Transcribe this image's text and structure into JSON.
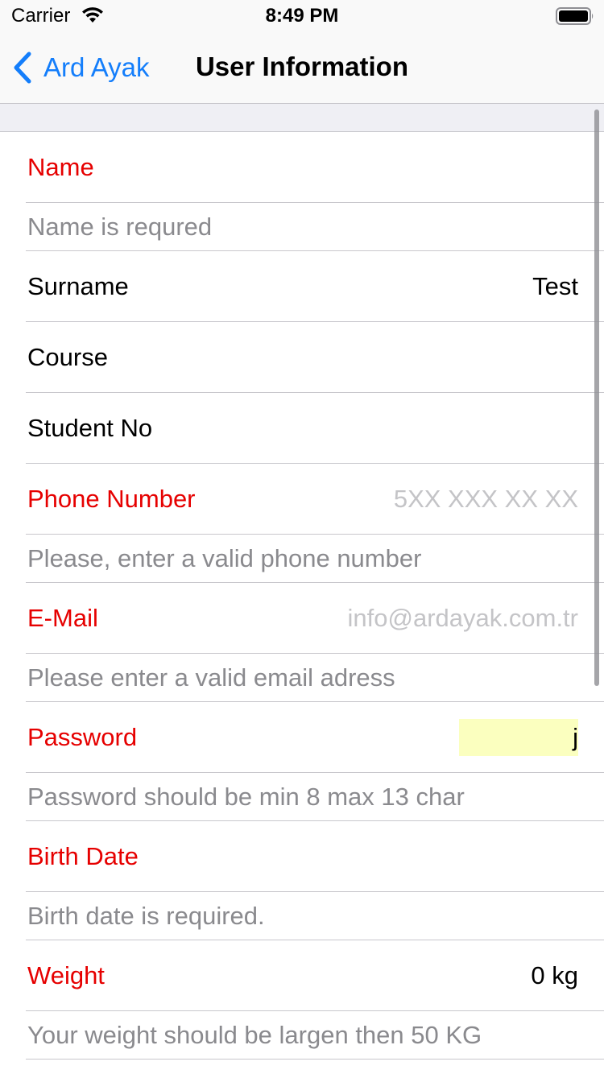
{
  "status_bar": {
    "carrier": "Carrier",
    "time": "8:49 PM",
    "wifi_icon": "wifi-icon",
    "battery_icon": "battery-icon"
  },
  "nav": {
    "back_label": "Ard Ayak",
    "title": "User Information"
  },
  "colors": {
    "error": "#e60000",
    "accent": "#147efb",
    "note": "#8a8a8e",
    "placeholder": "#c4c4c7",
    "highlight": "#fbffbf"
  },
  "form": {
    "name": {
      "label": "Name",
      "value": ""
    },
    "name_error": "Name is requred",
    "surname": {
      "label": "Surname",
      "value": "Test"
    },
    "course": {
      "label": "Course",
      "value": ""
    },
    "student_no": {
      "label": "Student No",
      "value": ""
    },
    "phone": {
      "label": "Phone Number",
      "value": "",
      "placeholder": "5XX XXX XX XX"
    },
    "phone_error": "Please, enter a valid phone number",
    "email": {
      "label": "E-Mail",
      "value": "",
      "placeholder": "info@ardayak.com.tr"
    },
    "email_error": "Please enter a valid email adress",
    "password": {
      "label": "Password",
      "value": "j"
    },
    "password_error": "Password should be min 8 max 13 char",
    "birth_date": {
      "label": "Birth Date",
      "value": ""
    },
    "birth_date_error": "Birth date is required.",
    "weight": {
      "label": "Weight",
      "value": "0 kg"
    },
    "weight_error": "Your weight should be largen then 50 KG"
  }
}
